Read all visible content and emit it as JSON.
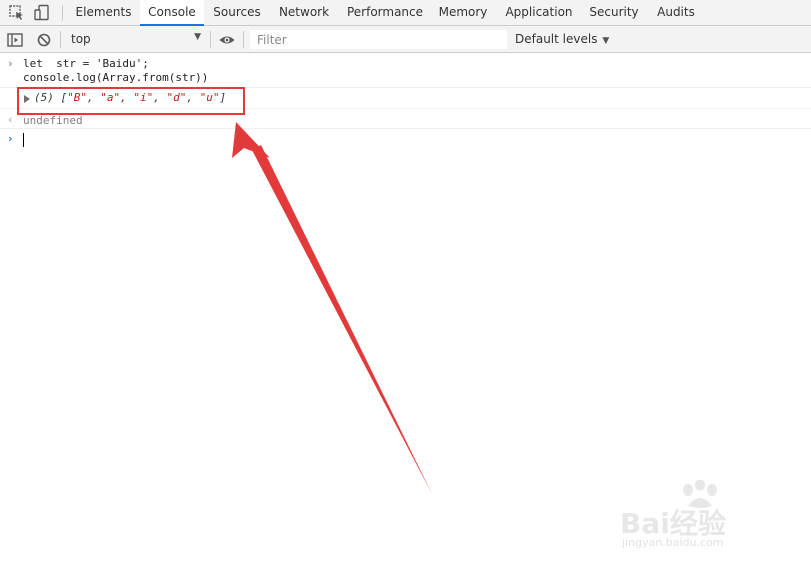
{
  "tabs": [
    {
      "label": "Elements",
      "active": false
    },
    {
      "label": "Console",
      "active": true
    },
    {
      "label": "Sources",
      "active": false
    },
    {
      "label": "Network",
      "active": false
    },
    {
      "label": "Performance",
      "active": false
    },
    {
      "label": "Memory",
      "active": false
    },
    {
      "label": "Application",
      "active": false
    },
    {
      "label": "Security",
      "active": false
    },
    {
      "label": "Audits",
      "active": false
    }
  ],
  "toolbar": {
    "context": "top",
    "filter_placeholder": "Filter",
    "levels": "Default levels"
  },
  "console": {
    "input_lines": [
      "let  str = 'Baidu';",
      "console.log(Array.from(str))"
    ],
    "output": {
      "length": "(5)",
      "items": [
        "\"B\"",
        "\"a\"",
        "\"i\"",
        "\"d\"",
        "\"u\""
      ]
    },
    "return_value": "undefined"
  },
  "annotation": {
    "color": "#e23a3a"
  },
  "watermark": {
    "text": "Bai经验",
    "url": "jingyan.baidu.com"
  }
}
